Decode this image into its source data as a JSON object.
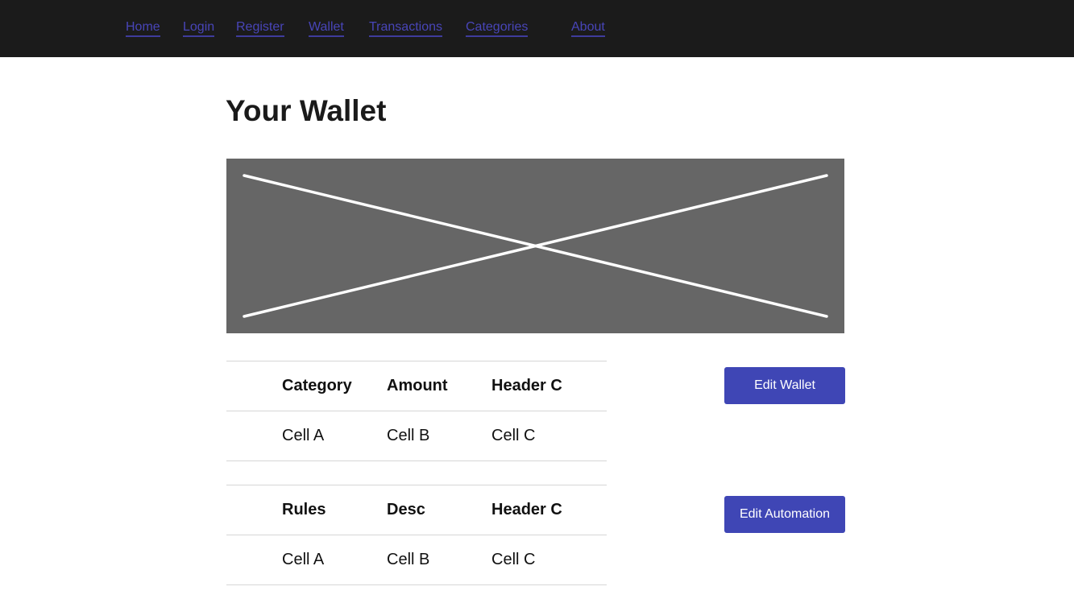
{
  "nav": {
    "items": [
      {
        "label": "Home"
      },
      {
        "label": "Login"
      },
      {
        "label": "Register"
      },
      {
        "label": "Wallet"
      },
      {
        "label": "Transactions"
      },
      {
        "label": "Categories"
      },
      {
        "label": "About"
      }
    ]
  },
  "page": {
    "title": "Your Wallet"
  },
  "wallet_table": {
    "headers": [
      "",
      "Category",
      "Amount",
      "Header C"
    ],
    "rows": [
      [
        "",
        "Cell A",
        "Cell B",
        "Cell C"
      ]
    ]
  },
  "automation_table": {
    "headers": [
      "",
      "Rules",
      "Desc",
      "Header C"
    ],
    "rows": [
      [
        "",
        "Cell A",
        "Cell B",
        "Cell C"
      ]
    ]
  },
  "actions": {
    "edit_wallet_label": "Edit Wallet",
    "edit_automation_label": "Edit Automation"
  },
  "colors": {
    "topbar_bg": "#1b1b1b",
    "nav_link": "#4845b8",
    "button_bg": "#3f46b5",
    "placeholder_bg": "#666666"
  }
}
